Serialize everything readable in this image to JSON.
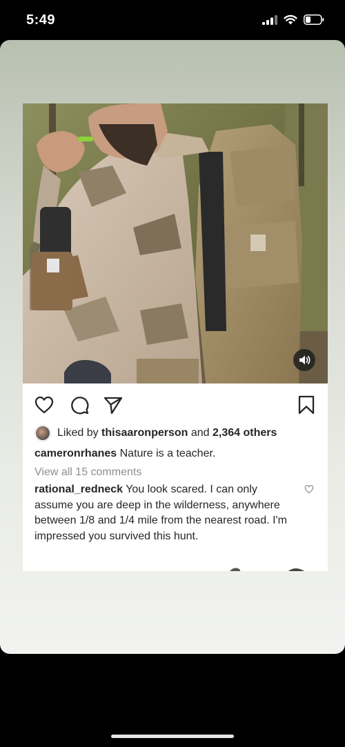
{
  "status_bar": {
    "time": "5:49"
  },
  "post": {
    "likes": {
      "prefix": "Liked by",
      "user": "thisaaronperson",
      "middle": "and",
      "others": "2,364 others"
    },
    "caption": {
      "username": "cameronrhanes",
      "text": "Nature is a teacher."
    },
    "view_comments": "View all 15 comments",
    "comment": {
      "username": "rational_redneck",
      "text": "You look scared. I can only assume you are deep in the wilderness, anywhere between 1/8 and 1/4 mile from the nearest road. I'm impressed you survived this hunt."
    },
    "icons": {
      "like": "heart-icon",
      "comment": "comment-icon",
      "share": "paper-plane-icon",
      "save": "bookmark-icon",
      "volume": "speaker-icon"
    }
  }
}
